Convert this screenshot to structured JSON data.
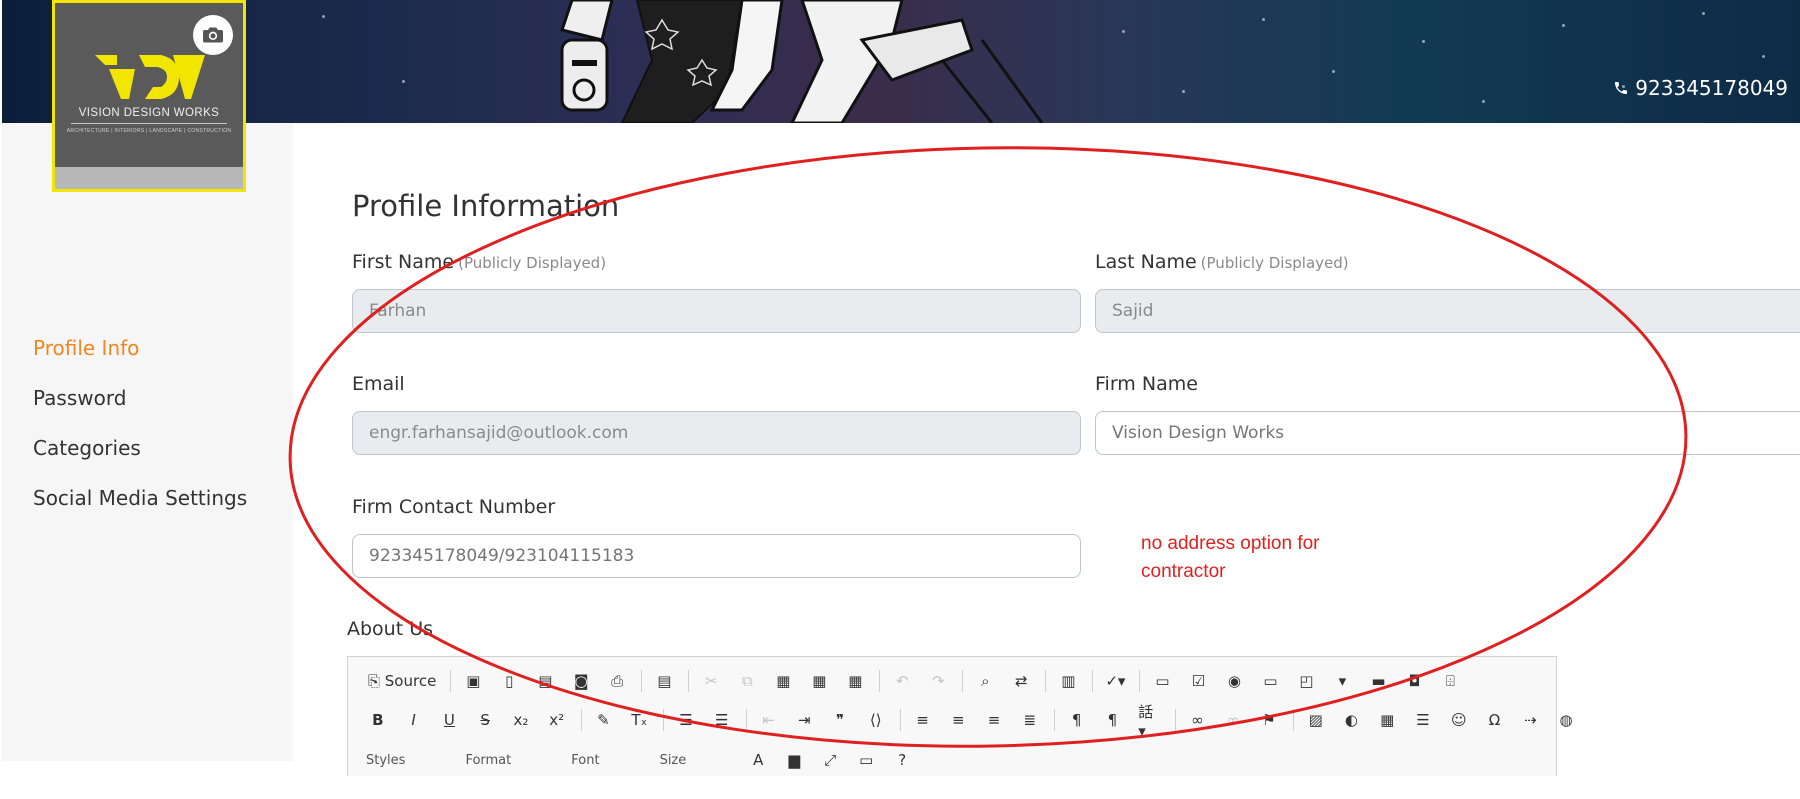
{
  "header": {
    "phone": "923345178049"
  },
  "logo": {
    "name": "VISION DESIGN WORKS",
    "tagline": "ARCHITECTURE | INTERIORS | LANDSCAPE | CONSTRUCTION",
    "border_color": "#f2e600",
    "mark_color": "#f2e600"
  },
  "sidebar": {
    "items": [
      {
        "label": "Profile Info",
        "active": true
      },
      {
        "label": "Password",
        "active": false
      },
      {
        "label": "Categories",
        "active": false
      },
      {
        "label": "Social Media Settings",
        "active": false
      }
    ],
    "active_color": "#f0861e"
  },
  "form": {
    "title": "Profile Information",
    "first_name": {
      "label": "First Name",
      "hint": "(Publicly Displayed)",
      "value": "Farhan"
    },
    "last_name": {
      "label": "Last Name",
      "hint": "(Publicly Displayed)",
      "value": "Sajid"
    },
    "email": {
      "label": "Email",
      "value": "engr.farhansajid@outlook.com"
    },
    "firm_name": {
      "label": "Firm Name",
      "value": "Vision Design Works"
    },
    "firm_contact": {
      "label": "Firm Contact Number",
      "value": "923345178049/923104115183"
    },
    "about_label": "About Us"
  },
  "annotation": {
    "note": "no address option for contractor",
    "color": "#e02020"
  },
  "editor": {
    "source_label": "Source",
    "row3": [
      "Styles",
      "Format",
      "Font",
      "Size"
    ]
  }
}
